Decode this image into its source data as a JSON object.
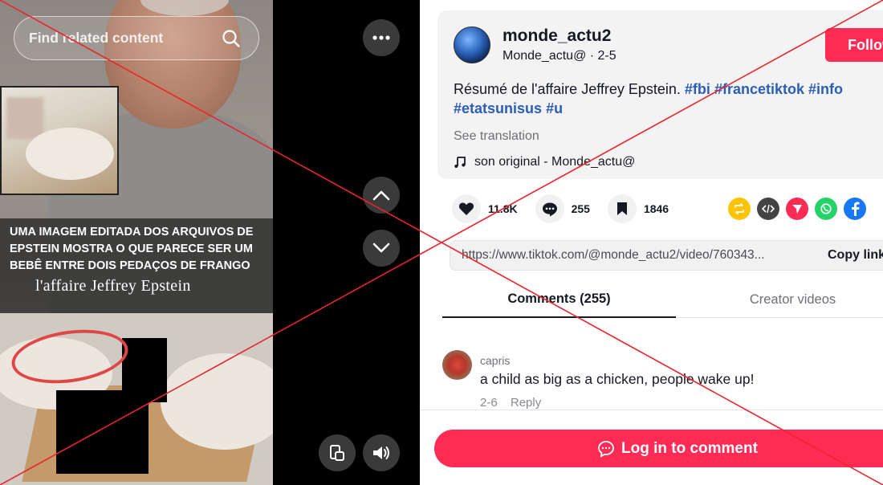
{
  "video": {
    "search_placeholder": "Find related content",
    "caption_text": "UMA IMAGEM EDITADA DOS ARQUIVOS DE EPSTEIN MOSTRA O QUE PARECE SER UM BEBÊ ENTRE DOIS PEDAÇOS DE FRANGO",
    "caption_title": "l'affaire Jeffrey Epstein"
  },
  "post": {
    "username": "monde_actu2",
    "handle": "Monde_actu@ · 2-5",
    "follow_label": "Follow",
    "description": "Résumé de l'affaire Jeffrey Epstein. ",
    "hashtags": [
      "#fbi",
      "#francetiktok",
      "#info",
      "#etatsunisus",
      "#u"
    ],
    "see_translation": "See translation",
    "music": "son original - Monde_actu@"
  },
  "stats": {
    "likes": "11.8K",
    "comments": "255",
    "saves": "1846"
  },
  "share": {
    "url": "https://www.tiktok.com/@monde_actu2/video/760343...",
    "copy_label": "Copy link",
    "icons": [
      "repost-icon",
      "embed-icon",
      "send-icon",
      "whatsapp-icon",
      "facebook-icon"
    ]
  },
  "tabs": {
    "comments": "Comments (255)",
    "creator": "Creator videos"
  },
  "comment": {
    "author": "capris",
    "text": "a child as big as a chicken, people wake up!",
    "date": "2-6",
    "reply": "Reply"
  },
  "footer": {
    "login": "Log in to comment"
  },
  "colors": {
    "accent": "#fe2c55",
    "hashtag": "#2b5db9",
    "overlay_x": "#e8262e"
  }
}
